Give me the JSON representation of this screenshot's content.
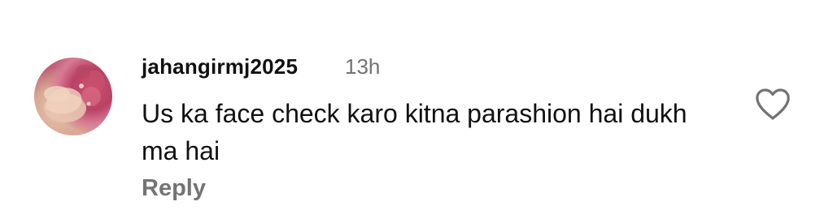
{
  "comment": {
    "username": "jahangirmj2025",
    "timestamp": "13h",
    "text": "Us ka face check karo kitna parashion hai dukh ma hai",
    "reply_label": "Reply",
    "like_icon": "heart-outline-icon",
    "avatar": "user-avatar"
  },
  "colors": {
    "username": "#111111",
    "secondary_text": "#737373",
    "background": "#ffffff"
  }
}
